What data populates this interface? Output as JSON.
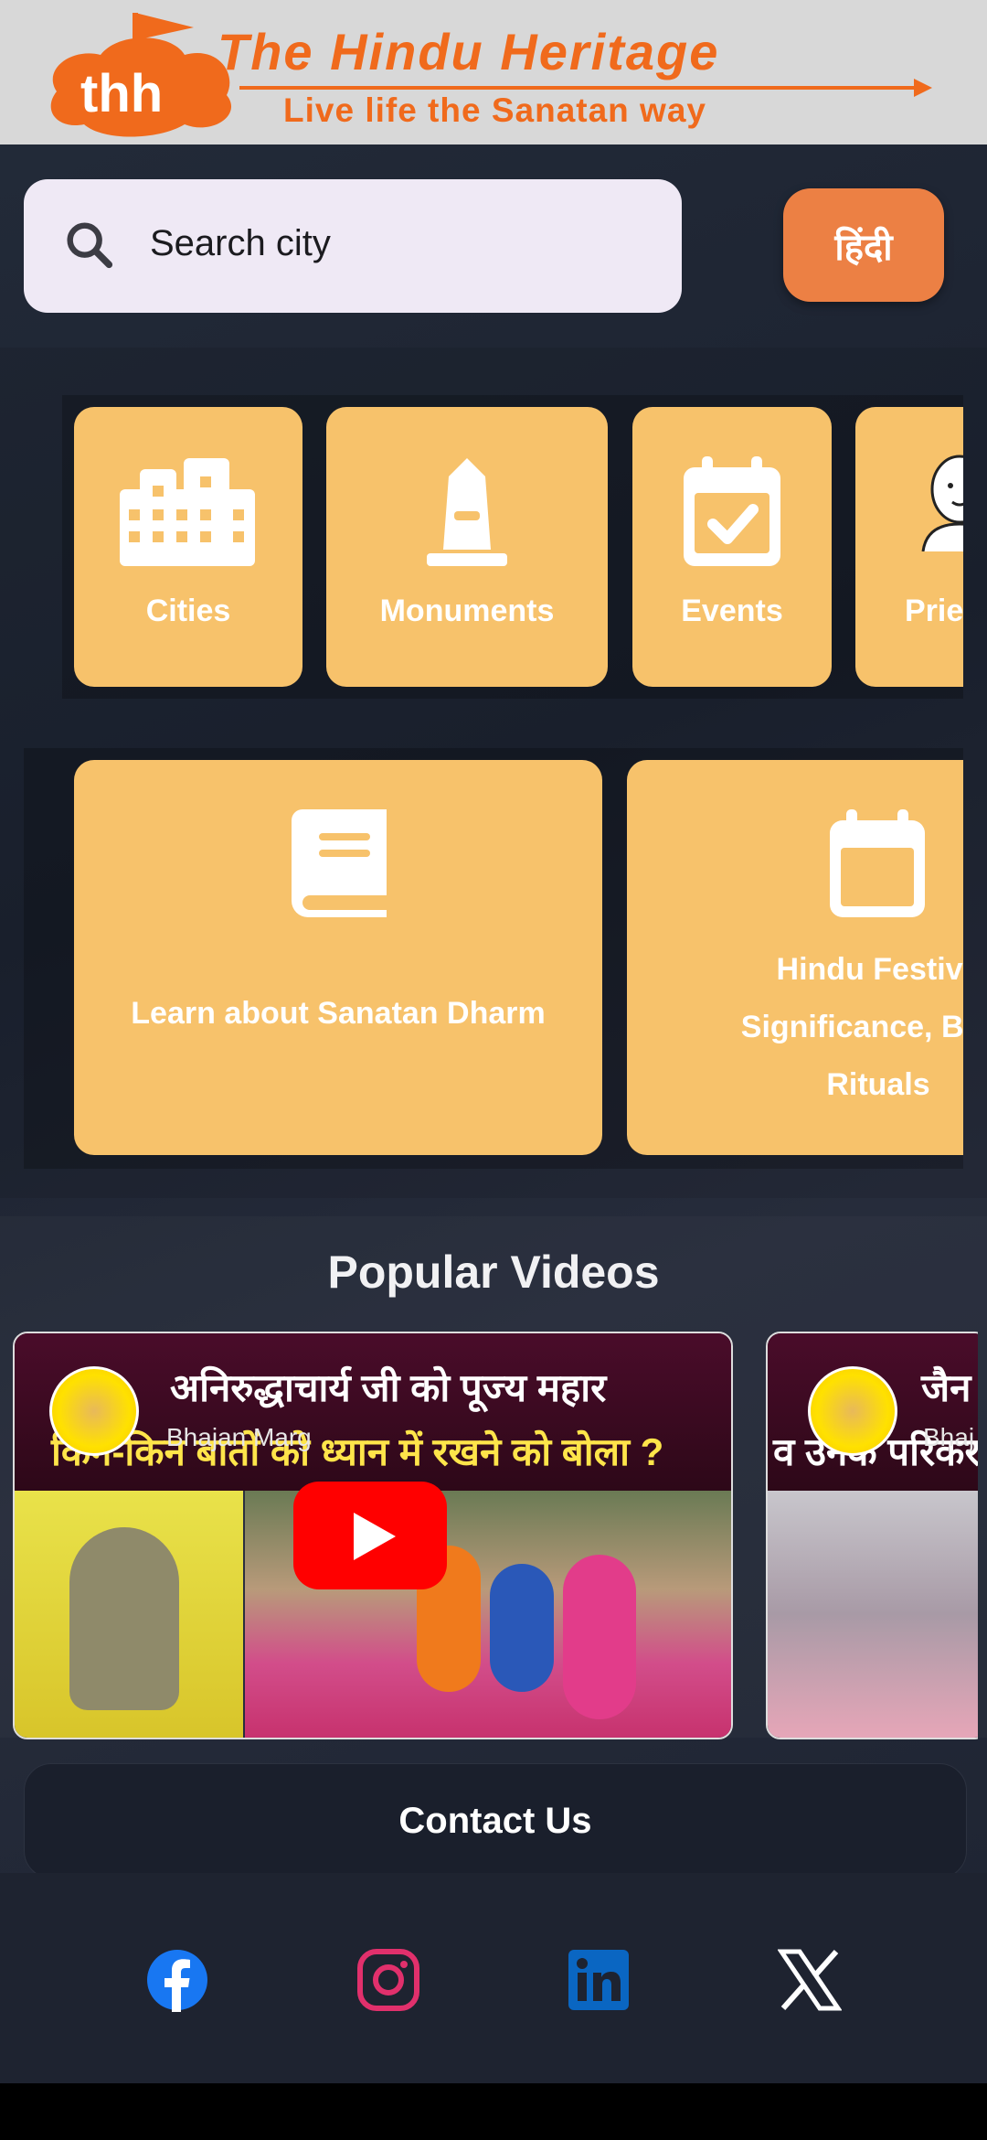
{
  "header": {
    "logo_mark": "thh",
    "brand_title": "The Hindu Heritage",
    "brand_tagline": "Live life the Sanatan way"
  },
  "search": {
    "placeholder": "Search city",
    "icon": "search-icon"
  },
  "language_button": {
    "label": "हिंदी"
  },
  "categories": [
    {
      "label": "Cities",
      "icon": "city-buildings-icon"
    },
    {
      "label": "Monuments",
      "icon": "monument-icon"
    },
    {
      "label": "Events",
      "icon": "calendar-check-icon"
    },
    {
      "label": "Prie",
      "icon": "priest-icon"
    }
  ],
  "learn_cards": [
    {
      "label": "Learn about Sanatan Dharm",
      "icon": "book-icon"
    },
    {
      "lines": [
        "Hindu Festiva",
        "Significance, Belie",
        "Rituals"
      ],
      "icon": "calendar-icon"
    }
  ],
  "popular_videos": {
    "title": "Popular Videos",
    "videos": [
      {
        "headline_line1": "अनिरुद्धाचार्य जी को पूज्य महार",
        "headline_line2": "किन-किन बातों को ध्यान में रखने को बोला ?",
        "channel": "Bhajan Marg",
        "play_icon": "youtube-play-icon"
      },
      {
        "headline_line1": "जैन",
        "headline_line2": "व उनके परिकर",
        "channel": "Bhaj"
      }
    ]
  },
  "contact": {
    "label": "Contact Us"
  },
  "social": [
    {
      "name": "facebook",
      "icon": "facebook-icon",
      "color": "#1877f2"
    },
    {
      "name": "instagram",
      "icon": "instagram-icon",
      "color": "#e1306c"
    },
    {
      "name": "linkedin",
      "icon": "linkedin-icon",
      "color": "#0a66c2"
    },
    {
      "name": "x",
      "icon": "x-twitter-icon",
      "color": "#ffffff"
    }
  ],
  "colors": {
    "accent_orange": "#f06a1c",
    "card_yellow": "#f7c26b",
    "language_button": "#ec8044",
    "background": "#1f2533"
  }
}
